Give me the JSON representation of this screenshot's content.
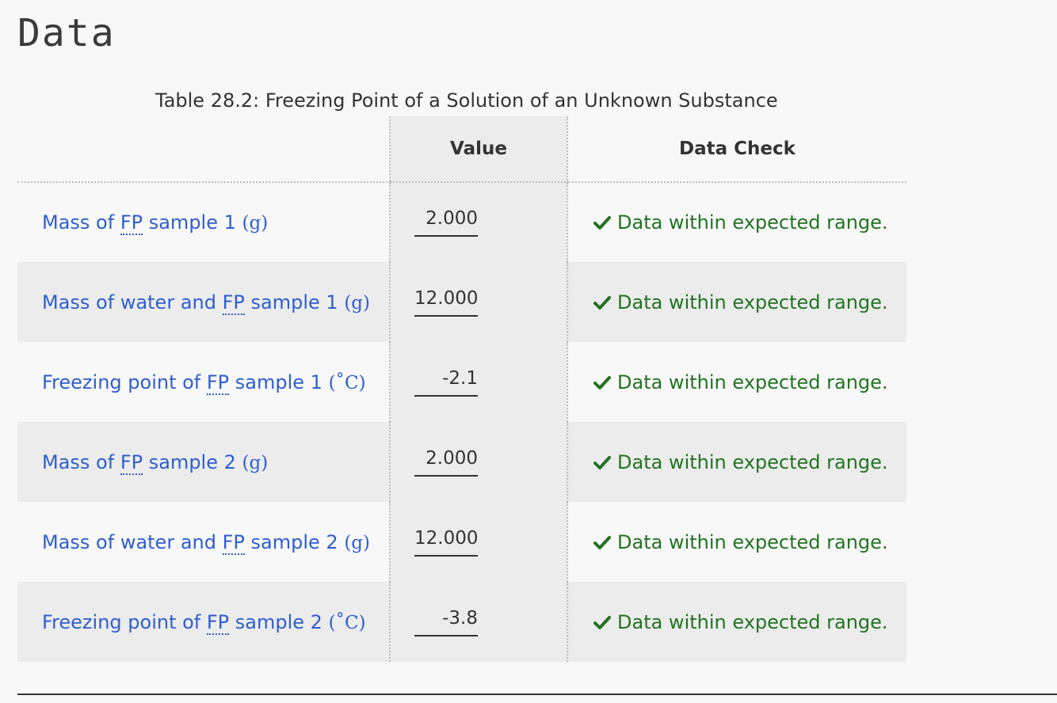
{
  "heading": "Data",
  "table": {
    "caption": "Table 28.2: Freezing Point of a Solution of an Unknown Substance",
    "headers": {
      "label": "",
      "value": "Value",
      "check": "Data Check"
    },
    "abbr": "FP",
    "rows": [
      {
        "pre": "Mass of ",
        "post": " sample 1 ",
        "unit": "(g)",
        "value": "2.000",
        "check": "Data within expected range."
      },
      {
        "pre": "Mass of water and ",
        "post": " sample 1 ",
        "unit": "(g)",
        "value": "12.000",
        "check": "Data within expected range."
      },
      {
        "pre": "Freezing point of ",
        "post": " sample 1 ",
        "unit": "(˚C)",
        "value": "-2.1",
        "check": "Data within expected range."
      },
      {
        "pre": "Mass of ",
        "post": " sample 2 ",
        "unit": "(g)",
        "value": "2.000",
        "check": "Data within expected range."
      },
      {
        "pre": "Mass of water and ",
        "post": " sample 2 ",
        "unit": "(g)",
        "value": "12.000",
        "check": "Data within expected range."
      },
      {
        "pre": "Freezing point of ",
        "post": " sample 2 ",
        "unit": "(˚C)",
        "value": "-3.8",
        "check": "Data within expected range."
      }
    ]
  },
  "colors": {
    "label": "#2e5ecf",
    "check": "#227322",
    "stripe": "#ececec"
  },
  "icons": {
    "check": "checkmark-icon"
  }
}
